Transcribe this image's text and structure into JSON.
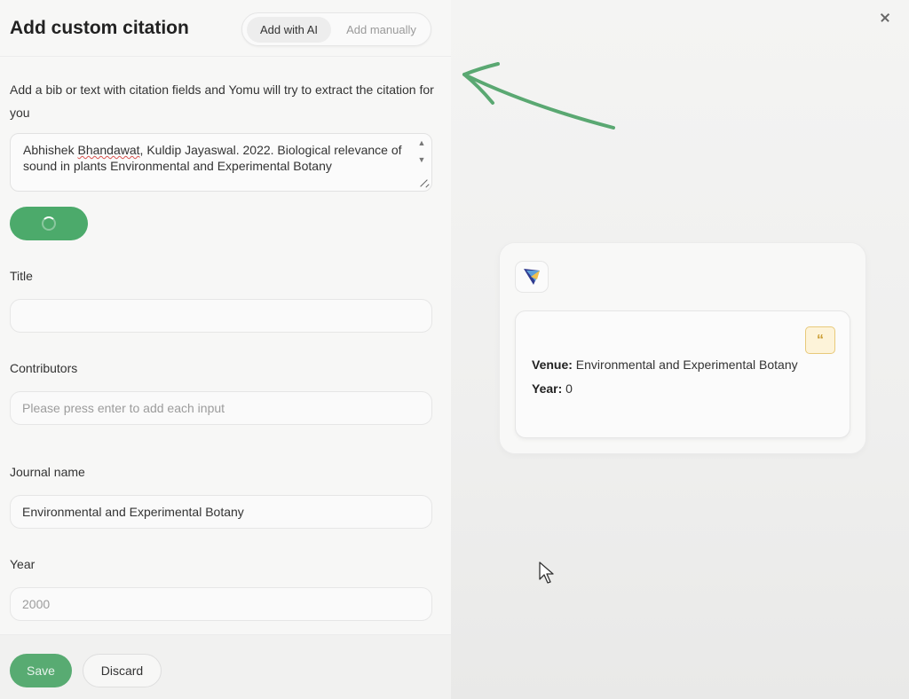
{
  "dialog": {
    "title": "Add custom citation",
    "tabs": [
      {
        "label": "Add with AI",
        "active": true
      },
      {
        "label": "Add manually",
        "active": false
      }
    ],
    "description": "Add a bib or text with citation fields and Yomu will try to extract the citation for you",
    "input_text_pre": "Abhishek ",
    "input_text_misspelled": "Bhandawat",
    "input_text_post": ", Kuldip Jayaswal. 2022. Biological relevance of sound in plants Environmental and Experimental Botany",
    "fields": {
      "title": {
        "label": "Title",
        "value": ""
      },
      "contributors": {
        "label": "Contributors",
        "placeholder": "Please press enter to add each input"
      },
      "journal": {
        "label": "Journal name",
        "value": "Environmental and Experimental Botany"
      },
      "year": {
        "label": "Year",
        "placeholder": "2000"
      }
    },
    "save_label": "Save",
    "discard_label": "Discard"
  },
  "preview": {
    "venue_label": "Venue:",
    "venue_value": " Environmental and Experimental Botany",
    "year_label": "Year:",
    "year_value": " 0",
    "quote_glyph": "“"
  },
  "colors": {
    "accent_green": "#4caa6b",
    "arrow_green": "#5aa872",
    "quote_bg": "#fdf3d9"
  },
  "icons": [
    "close-icon",
    "spinner-icon",
    "yomu-logo-icon",
    "quote-icon",
    "resize-icon",
    "mouse-cursor-icon",
    "annotation-arrow"
  ]
}
